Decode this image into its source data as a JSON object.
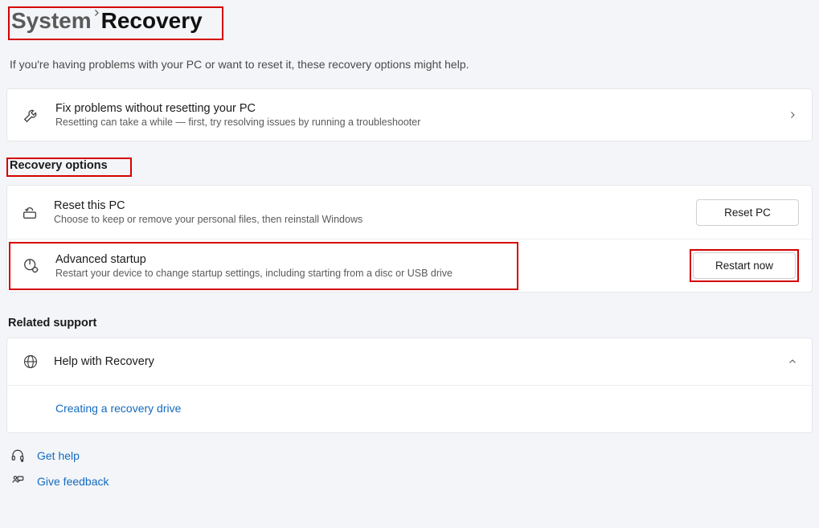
{
  "breadcrumb": {
    "parent": "System",
    "current": "Recovery"
  },
  "subtitle": "If you're having problems with your PC or want to reset it, these recovery options might help.",
  "troubleshooter": {
    "title": "Fix problems without resetting your PC",
    "desc": "Resetting can take a while — first, try resolving issues by running a troubleshooter"
  },
  "sections": {
    "recovery_options": "Recovery options",
    "related_support": "Related support"
  },
  "recovery": {
    "reset": {
      "title": "Reset this PC",
      "desc": "Choose to keep or remove your personal files, then reinstall Windows",
      "button": "Reset PC"
    },
    "advanced": {
      "title": "Advanced startup",
      "desc": "Restart your device to change startup settings, including starting from a disc or USB drive",
      "button": "Restart now"
    }
  },
  "help": {
    "title": "Help with Recovery",
    "item1": "Creating a recovery drive"
  },
  "footer": {
    "get_help": "Get help",
    "give_feedback": "Give feedback"
  }
}
